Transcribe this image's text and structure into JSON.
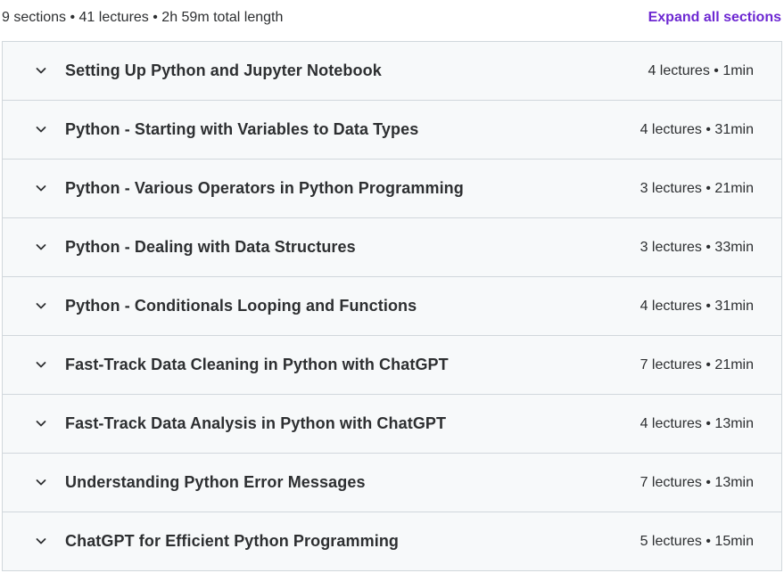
{
  "curriculum": {
    "summary": "9 sections • 41 lectures • 2h 59m total length",
    "expand_all_label": "Expand all sections",
    "accent_color": "#6d28d2",
    "sections": [
      {
        "title": "Setting Up Python and Jupyter Notebook",
        "meta": "4 lectures • 1min",
        "icon": "chevron-down-icon"
      },
      {
        "title": "Python - Starting with Variables to Data Types",
        "meta": "4 lectures • 31min",
        "icon": "chevron-down-icon"
      },
      {
        "title": "Python - Various Operators in Python Programming",
        "meta": "3 lectures • 21min",
        "icon": "chevron-down-icon"
      },
      {
        "title": "Python - Dealing with Data Structures",
        "meta": "3 lectures • 33min",
        "icon": "chevron-down-icon"
      },
      {
        "title": "Python - Conditionals Looping and Functions",
        "meta": "4 lectures • 31min",
        "icon": "chevron-down-icon"
      },
      {
        "title": "Fast-Track Data Cleaning in Python with ChatGPT",
        "meta": "7 lectures • 21min",
        "icon": "chevron-down-icon"
      },
      {
        "title": "Fast-Track Data Analysis in Python with ChatGPT",
        "meta": "4 lectures • 13min",
        "icon": "chevron-down-icon"
      },
      {
        "title": "Understanding Python Error Messages",
        "meta": "7 lectures • 13min",
        "icon": "chevron-down-icon"
      },
      {
        "title": "ChatGPT for Efficient Python Programming",
        "meta": "5 lectures • 15min",
        "icon": "chevron-down-icon"
      }
    ]
  }
}
